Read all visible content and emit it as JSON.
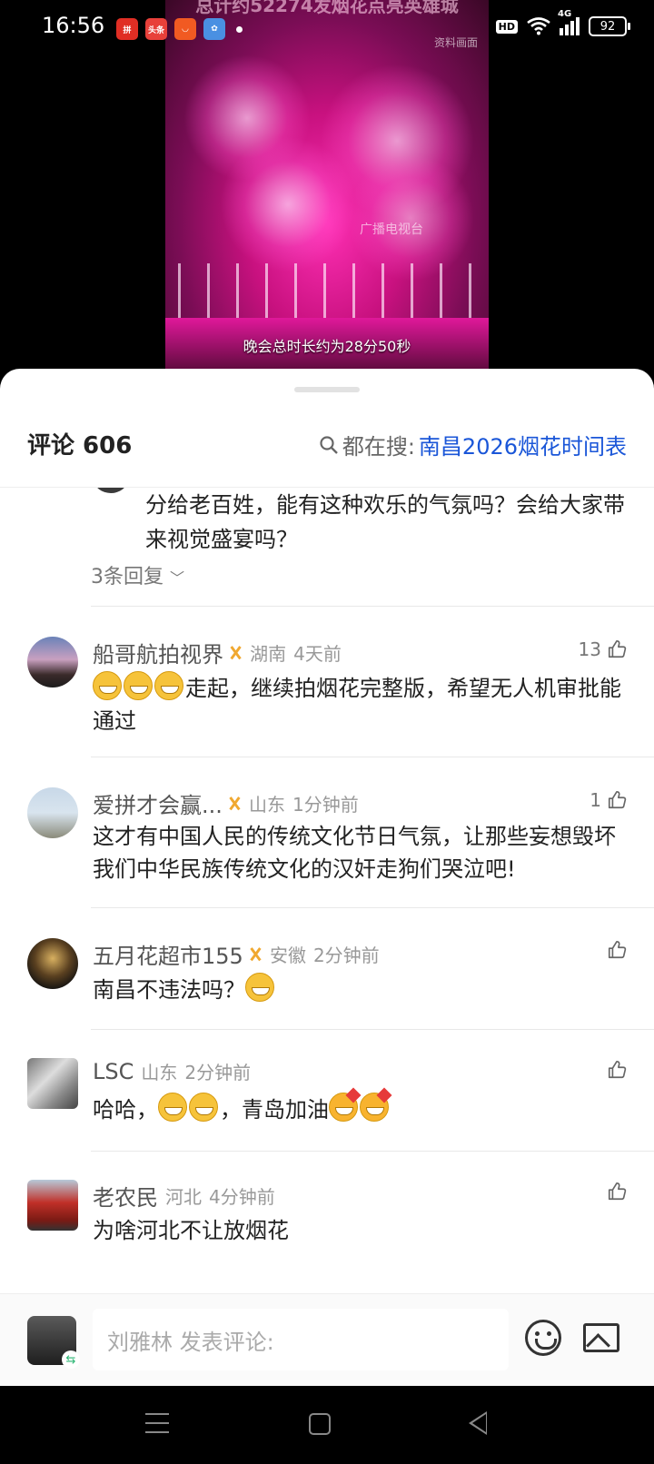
{
  "status_bar": {
    "time": "16:56",
    "app_icons": [
      {
        "name": "pinduoduo-icon",
        "label": "拼",
        "color": "#e02e24"
      },
      {
        "name": "toutiao-icon",
        "label": "头条",
        "color": "#e8403a"
      },
      {
        "name": "meituan-icon",
        "label": "",
        "color": "#f15a22"
      },
      {
        "name": "photos-icon",
        "label": "",
        "color": "#4a90e2"
      }
    ],
    "hd": "HD",
    "network": "4G",
    "battery": "92"
  },
  "video": {
    "top_caption": "总计约52274发烟花点亮英雄城",
    "source_watermark": "资料画面",
    "channel_watermark": "广播电视台",
    "subtitle": "晚会总时长约为28分50秒"
  },
  "comments_header": {
    "title": "评论 606",
    "trending_prefix": "都在搜:",
    "trending_term": "南昌2026烟花时间表"
  },
  "partial_comment": {
    "text": "分给老百姓，能有这种欢乐的气氛吗？会给大家带来视觉盛宴吗？",
    "replies": "3条回复"
  },
  "comments": [
    {
      "username": "船哥航拍视界",
      "location": "湖南",
      "time_ago": "4天前",
      "likes": "13",
      "text": "走起，继续拍烟花完整版，希望无人机审批能通过",
      "emoji_before": 3,
      "badge": true
    },
    {
      "username": "爱拼才会赢...",
      "location": "山东",
      "time_ago": "1分钟前",
      "likes": "1",
      "text": "这才有中国人民的传统文化节日气氛，让那些妄想毁坏我们中华民族传统文化的汉奸走狗们哭泣吧!",
      "badge": true
    },
    {
      "username": "五月花超市155",
      "location": "安徽",
      "time_ago": "2分钟前",
      "likes": "",
      "text_a": "南昌不违法吗？",
      "badge": true
    },
    {
      "username": "LSC",
      "location": "山东",
      "time_ago": "2分钟前",
      "likes": "",
      "text_a": "哈哈，",
      "text_b": "，青岛加油",
      "badge": false
    },
    {
      "username": "老农民",
      "location": "河北",
      "time_ago": "4分钟前",
      "likes": "",
      "text": "为啥河北不让放烟花",
      "badge": false
    }
  ],
  "input_bar": {
    "placeholder": "刘雅林 发表评论:"
  },
  "colors": {
    "accent_link": "#1a56d8",
    "badge_gold": "#f0a830"
  }
}
